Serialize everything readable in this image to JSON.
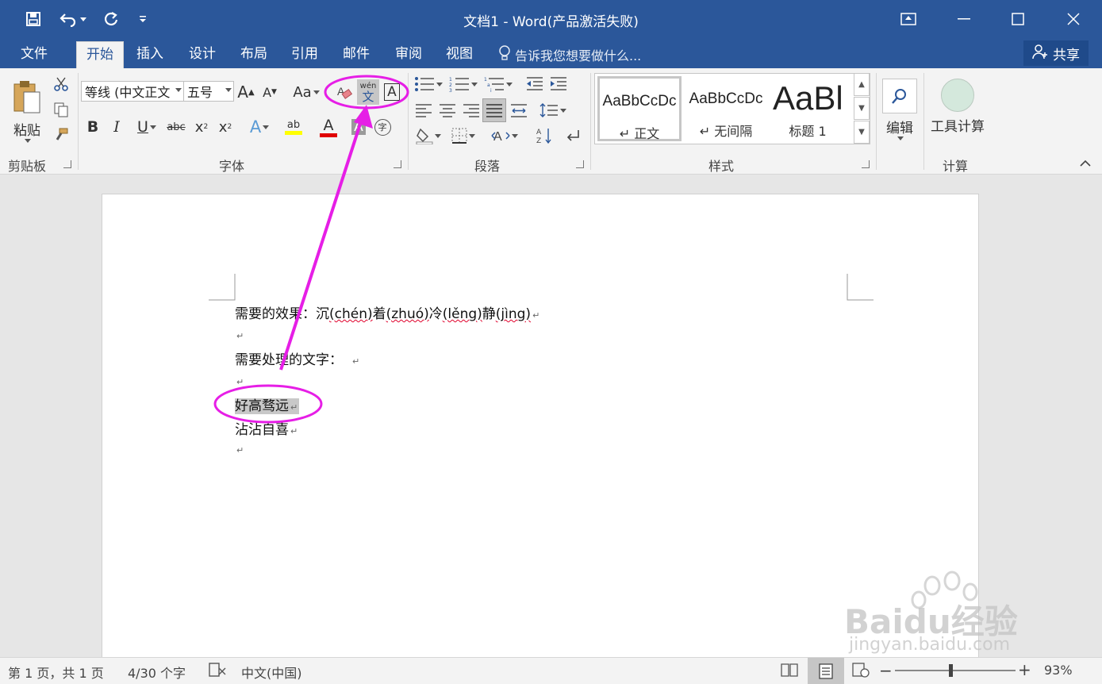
{
  "window": {
    "title": "文档1 - Word(产品激活失败)",
    "title_bar_color": "#2b579a"
  },
  "quick_access": {
    "save_icon": "save-icon",
    "undo_icon": "undo-icon",
    "redo_icon": "redo-icon",
    "customize_icon": "customize-icon"
  },
  "tabs": [
    {
      "label": "文件"
    },
    {
      "label": "开始",
      "active": true
    },
    {
      "label": "插入"
    },
    {
      "label": "设计"
    },
    {
      "label": "布局"
    },
    {
      "label": "引用"
    },
    {
      "label": "邮件"
    },
    {
      "label": "审阅"
    },
    {
      "label": "视图"
    }
  ],
  "tell_me": "告诉我您想要做什么...",
  "share_label": "共享",
  "ribbon": {
    "clipboard": {
      "paste_label": "粘贴",
      "group_label": "剪贴板"
    },
    "font": {
      "font_name": "等线 (中文正文",
      "font_size": "五号",
      "group_label": "字体",
      "case_label": "Aa",
      "phonetic_top": "wén",
      "phonetic_bottom": "文",
      "border_char": "A",
      "enclose_char": "字",
      "highlight_color": "#ffff00",
      "font_color": "#e00000"
    },
    "paragraph": {
      "group_label": "段落"
    },
    "styles": {
      "group_label": "样式",
      "items": [
        {
          "sample": "AaBbCcDc",
          "name": "↵ 正文"
        },
        {
          "sample": "AaBbCcDc",
          "name": "↵ 无间隔"
        },
        {
          "sample": "AaBl",
          "name": "标题 1"
        }
      ]
    },
    "editing": {
      "label": "编辑"
    },
    "calc": {
      "button_label": "工具计算",
      "group_label": "计算"
    }
  },
  "document": {
    "line1": {
      "prefix": "需要的效果：沉",
      "p1": "(chén)",
      "c2": "着",
      "p2": "(zhuó)",
      "c3": "冷",
      "p3": "(lěng)",
      "c4": "静",
      "p4": "(jìng)"
    },
    "line2": "需要处理的文字：",
    "line3": "好高骛远",
    "line4": "沾沾自喜",
    "paragraph_mark": "↵"
  },
  "status": {
    "page": "第 1 页，共 1 页",
    "words": "4/30 个字",
    "language": "中文(中国)",
    "zoom": "93%",
    "zoom_level": 0.93
  },
  "watermark": {
    "brand": "Baidu经验",
    "url": "jingyan.baidu.com"
  },
  "annotation_color": "#e61ee6"
}
